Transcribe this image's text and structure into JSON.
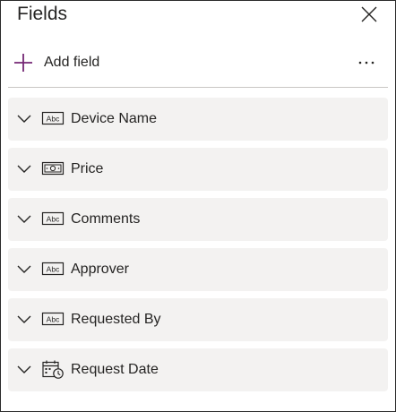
{
  "header": {
    "title": "Fields"
  },
  "toolbar": {
    "add_label": "Add field",
    "more_label": "···"
  },
  "fields": [
    {
      "label": "Device Name",
      "type": "text",
      "type_label": "Abc"
    },
    {
      "label": "Price",
      "type": "currency",
      "type_label": ""
    },
    {
      "label": "Comments",
      "type": "text",
      "type_label": "Abc"
    },
    {
      "label": "Approver",
      "type": "text",
      "type_label": "Abc"
    },
    {
      "label": "Requested By",
      "type": "text",
      "type_label": "Abc"
    },
    {
      "label": "Request Date",
      "type": "date",
      "type_label": ""
    }
  ],
  "colors": {
    "accent": "#742774",
    "text": "#252423",
    "item_background": "#f3f2f1",
    "divider": "#c8c6c4"
  },
  "icons": {
    "close": "close-icon",
    "add": "plus-icon",
    "more": "more-horizontal-icon",
    "expand": "chevron-down-icon",
    "text": "text-field-icon",
    "currency": "currency-field-icon",
    "date": "date-field-icon"
  }
}
